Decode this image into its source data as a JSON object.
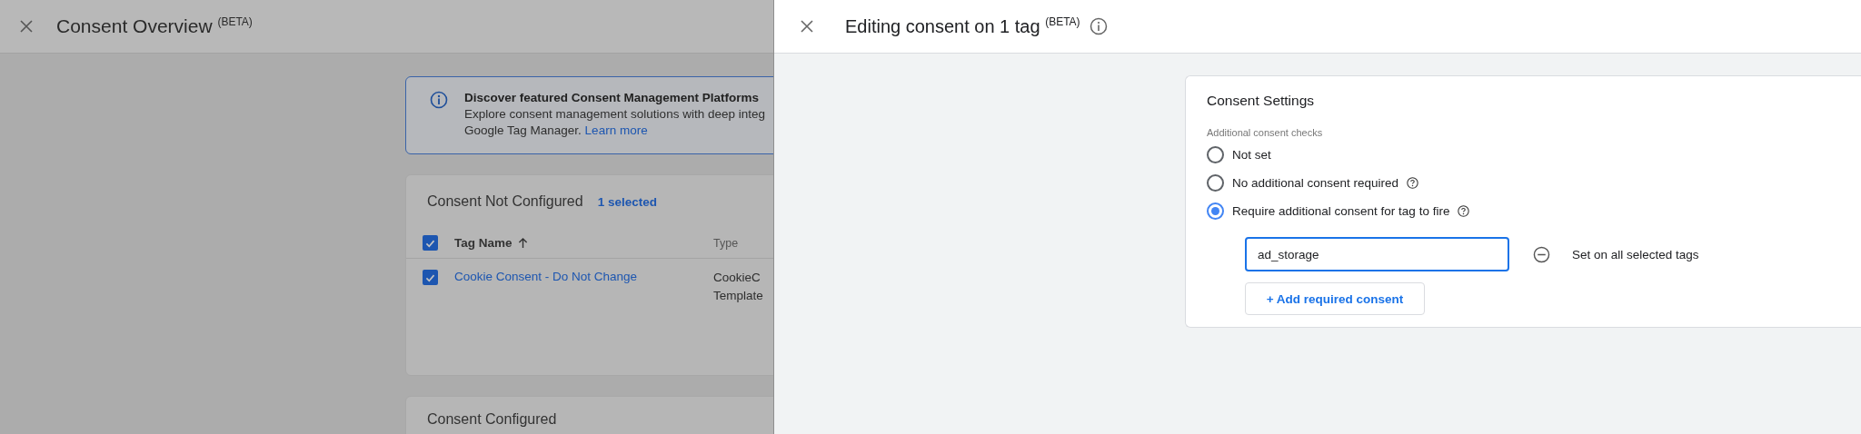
{
  "overview": {
    "title": "Consent Overview",
    "badge": "(BETA)",
    "banner": {
      "title": "Discover featured Consent Management Platforms",
      "lines": [
        "Explore consent management solutions with deep integ",
        "Google Tag Manager."
      ],
      "link": "Learn more"
    },
    "not_configured": {
      "title": "Consent Not Configured",
      "selection": "1 selected",
      "header_checked": true,
      "columns": [
        "Tag Name",
        "Type"
      ],
      "rows": [
        {
          "checked": true,
          "name": "Cookie Consent - Do Not Change",
          "type": [
            "CookieC",
            "Template"
          ]
        }
      ]
    },
    "configured": {
      "title": "Consent Configured"
    }
  },
  "editor": {
    "title": "Editing consent on 1 tag",
    "badge": "(BETA)",
    "card_title": "Consent Settings",
    "group_label": "Additional consent checks",
    "options": [
      {
        "label": "Not set",
        "selected": false,
        "help": false
      },
      {
        "label": "No additional consent required",
        "selected": false,
        "help": true
      },
      {
        "label": "Require additional consent for tag to fire",
        "selected": true,
        "help": true
      }
    ],
    "consents": [
      {
        "value": "ad_storage"
      }
    ],
    "scope_label": "Set on all selected tags",
    "add_button": "+ Add required consent"
  }
}
